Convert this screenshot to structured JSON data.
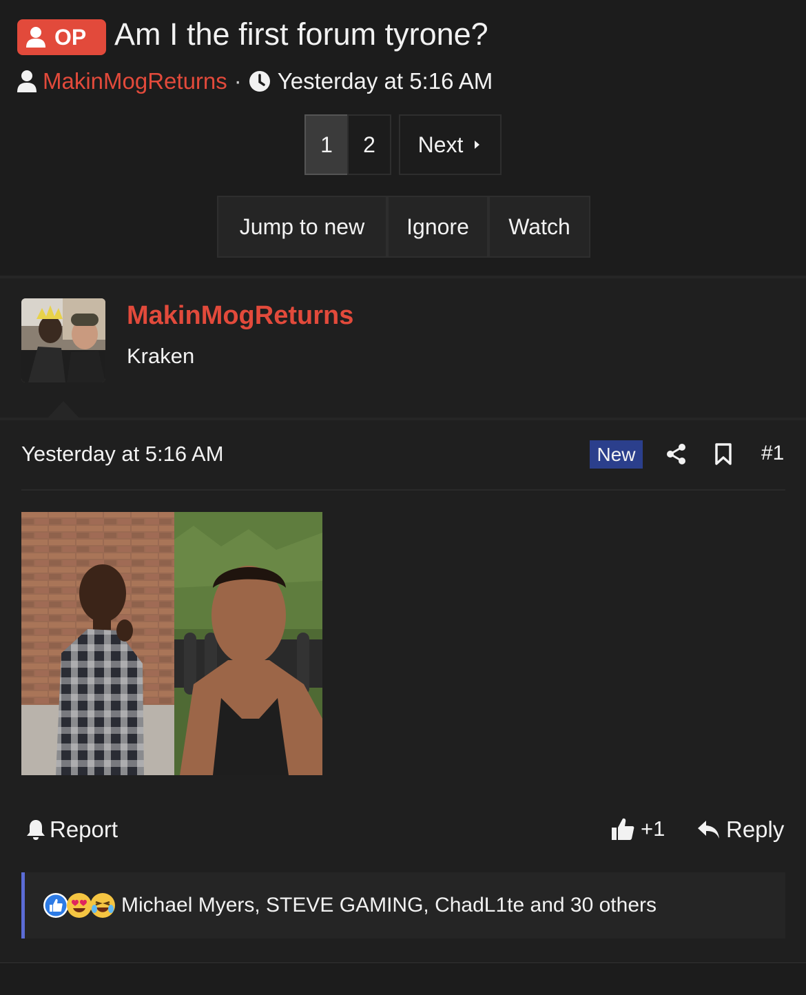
{
  "thread": {
    "op_label": "OP",
    "title": "Am I the first forum tyrone?",
    "author": "MakinMogReturns",
    "separator": "·",
    "time": "Yesterday at 5:16 AM"
  },
  "pagination": {
    "pages": [
      "1",
      "2"
    ],
    "current": "1",
    "next_label": "Next"
  },
  "thread_actions": [
    "Jump to new",
    "Ignore",
    "Watch"
  ],
  "post": {
    "username": "MakinMogReturns",
    "user_title": "Kraken",
    "time": "Yesterday at 5:16 AM",
    "new_label": "New",
    "number": "#1",
    "report_label": "Report",
    "like_count": "+1",
    "reply_label": "Reply",
    "reactions_text": "Michael Myers, STEVE GAMING, ChadL1te and 30 others"
  },
  "colors": {
    "accent": "#e24a3b",
    "new_badge": "#2b3f8c",
    "reaction_bar": "#5b6cd6"
  },
  "icons": [
    "user-icon",
    "clock-icon",
    "caret-right-icon",
    "share-icon",
    "bookmark-icon",
    "bell-icon",
    "thumbs-up-icon",
    "reply-icon",
    "like-reaction-icon",
    "love-reaction-icon",
    "haha-reaction-icon"
  ]
}
